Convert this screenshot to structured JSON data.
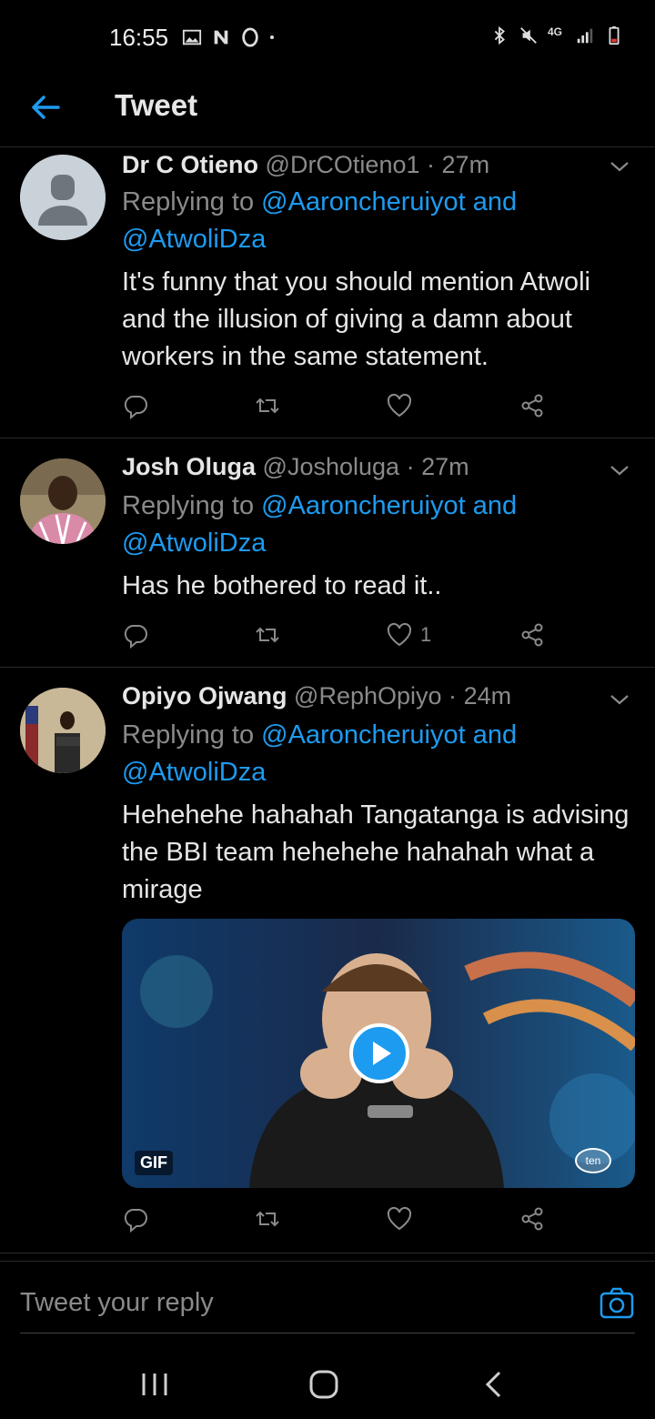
{
  "status_bar": {
    "time": "16:55",
    "left_icons": [
      "gallery-icon",
      "n-icon",
      "opera-icon",
      "dot-icon"
    ],
    "right_icons": [
      "bluetooth-icon",
      "mute-icon",
      "4g-icon",
      "signal-icon",
      "battery-icon"
    ],
    "network": "4G"
  },
  "header": {
    "title": "Tweet"
  },
  "tweets": [
    {
      "name": "Dr C Otieno",
      "handle": "@DrCOtieno1",
      "dot": "·",
      "time": "27m",
      "replying_prefix": "Replying to ",
      "replying_user1": "@Aaroncheruiyot",
      "replying_and": " and",
      "replying_user2": "@AtwoliDza",
      "text": "It's funny that you should mention Atwoli and the illusion of giving a damn about workers in the same statement.",
      "like_count": ""
    },
    {
      "name": "Josh Oluga",
      "handle": "@Josholuga",
      "dot": "·",
      "time": "27m",
      "replying_prefix": "Replying to ",
      "replying_user1": "@Aaroncheruiyot",
      "replying_and": " and",
      "replying_user2": "@AtwoliDza",
      "text": "Has he bothered to read it..",
      "like_count": "1"
    },
    {
      "name": "Opiyo Ojwang",
      "handle": "@RephOpiyo",
      "dot": "·",
      "time": "24m",
      "replying_prefix": "Replying to ",
      "replying_user1": "@Aaroncheruiyot",
      "replying_and": " and",
      "replying_user2": "@AtwoliDza",
      "text": "Hehehehe hahahah Tangatanga is advising the BBI team hehehehe hahahah what a mirage",
      "like_count": "",
      "media": {
        "badge": "GIF",
        "watermark": "ten"
      }
    }
  ],
  "reply_bar": {
    "placeholder": "Tweet your reply"
  },
  "colors": {
    "accent": "#1d9bf0",
    "background": "#000000",
    "secondary_text": "#8a8a8a"
  }
}
